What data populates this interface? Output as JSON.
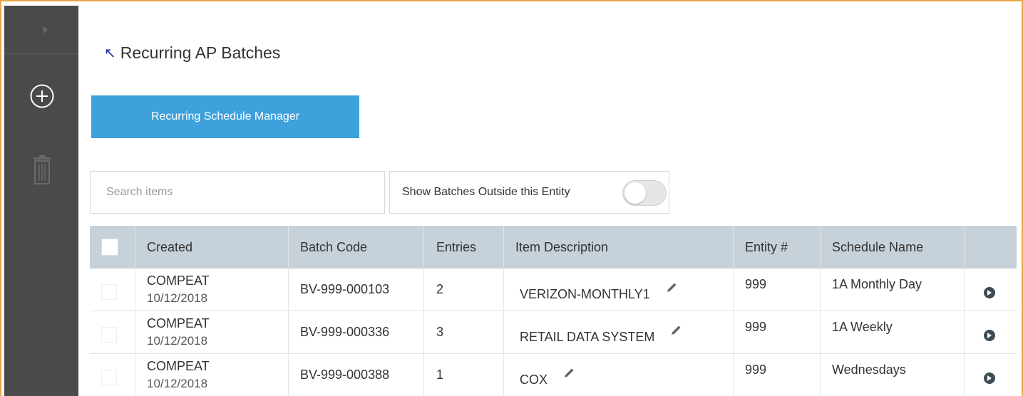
{
  "page": {
    "title": "Recurring AP Batches",
    "title_icon": "arrow-up-left-icon"
  },
  "sidebar": {
    "expand_icon": "chevron-right-icon",
    "add_icon": "plus-circle-icon",
    "delete_icon": "trash-icon"
  },
  "actions": {
    "schedule_manager_label": "Recurring Schedule Manager"
  },
  "search": {
    "placeholder": "Search items",
    "value": ""
  },
  "filter": {
    "show_outside_label": "Show Batches Outside this Entity",
    "show_outside_on": false
  },
  "table": {
    "columns": [
      "Created",
      "Batch Code",
      "Entries",
      "Item Description",
      "Entity #",
      "Schedule Name",
      ""
    ],
    "rows": [
      {
        "created_by": "COMPEAT",
        "created_date": "10/12/2018",
        "batch_code": "BV-999-000103",
        "entries": "2",
        "description": "VERIZON-MONTHLY1",
        "entity": "999",
        "schedule": "1A Monthly Day"
      },
      {
        "created_by": "COMPEAT",
        "created_date": "10/12/2018",
        "batch_code": "BV-999-000336",
        "entries": "3",
        "description": "RETAIL DATA SYSTEM",
        "entity": "999",
        "schedule": "1A Weekly"
      },
      {
        "created_by": "COMPEAT",
        "created_date": "10/12/2018",
        "batch_code": "BV-999-000388",
        "entries": "1",
        "description": "COX",
        "entity": "999",
        "schedule": "Wednesdays"
      }
    ]
  },
  "colors": {
    "accent": "#3ea1dc",
    "sidebar": "#4a4a4a",
    "header": "#c6d1d9",
    "frame": "#e8a54a"
  }
}
